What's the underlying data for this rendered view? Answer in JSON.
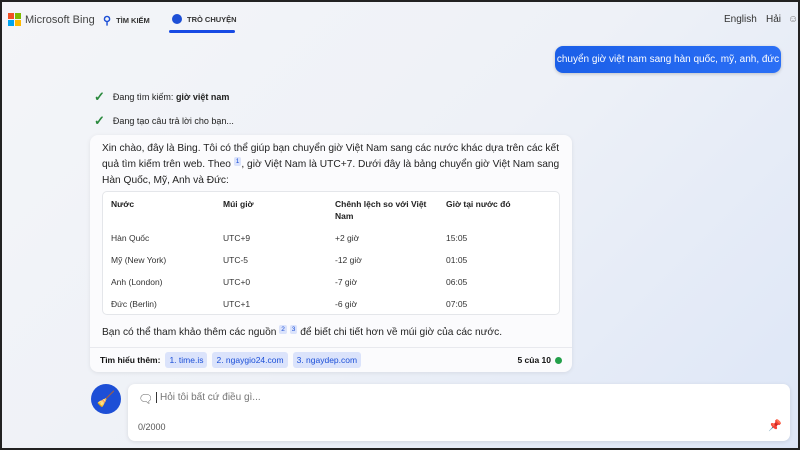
{
  "header": {
    "brand": "Microsoft Bing",
    "tabs": [
      {
        "label": "TÌM KIẾM"
      },
      {
        "label": "TRÒ CHUYỆN"
      }
    ],
    "language": "English",
    "user": "Hải"
  },
  "user_message": "chuyển giờ việt nam sang hàn quốc, mỹ, anh, đức",
  "status": [
    {
      "prefix": "Đang tìm kiếm: ",
      "query": "giờ việt nam"
    },
    {
      "prefix": "Đang tạo câu trả lời cho bạn..."
    }
  ],
  "answer": {
    "intro_1": "Xin chào, đây là Bing. Tôi có thể giúp bạn chuyển giờ Việt Nam sang các nước khác dựa trên các kết quả tìm kiếm trên web. Theo ",
    "ref_1": "1",
    "intro_2": ", giờ Việt Nam là UTC+7. Dưới đây là bảng chuyển giờ Việt Nam sang Hàn Quốc, Mỹ, Anh và Đức:",
    "table": {
      "headers": [
        "Nước",
        "Múi giờ",
        "Chênh lệch so với Việt Nam",
        "Giờ tại nước đó"
      ],
      "rows": [
        [
          "Hàn Quốc",
          "UTC+9",
          "+2 giờ",
          "15:05"
        ],
        [
          "Mỹ (New York)",
          "UTC-5",
          "-12 giờ",
          "01:05"
        ],
        [
          "Anh (London)",
          "UTC+0",
          "-7 giờ",
          "06:05"
        ],
        [
          "Đức (Berlin)",
          "UTC+1",
          "-6 giờ",
          "07:05"
        ]
      ]
    },
    "outro_1": "Bạn có thể tham khảo thêm các nguồn ",
    "ref_2": "2",
    "ref_3": "3",
    "outro_2": " để biết chi tiết hơn về múi giờ của các nước.",
    "learn_more_label": "Tìm hiểu thêm:",
    "sources": [
      "1. time.is",
      "2. ngaygio24.com",
      "3. ngaydep.com"
    ],
    "turn_count": "5 của 10"
  },
  "input": {
    "placeholder": "Hỏi tôi bất cứ điều gì...",
    "char_count": "0/2000"
  },
  "colors": {
    "accent": "#174ae4",
    "status_dot": "#23a04a"
  }
}
